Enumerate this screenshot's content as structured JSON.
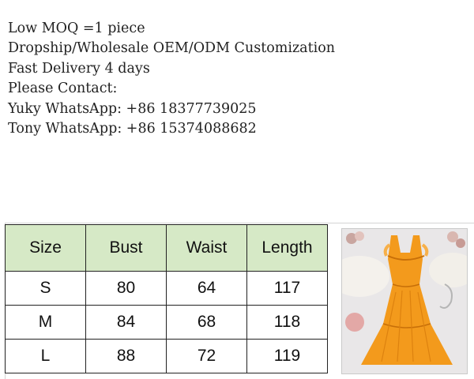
{
  "info_lines": [
    "Low MOQ =1 piece",
    "Dropship/Wholesale OEM/ODM Customization",
    "Fast Delivery 4 days",
    "Please Contact:",
    "Yuky WhatsApp: +86 18377739025",
    "Tony WhatsApp: +86 15374088682"
  ],
  "size_table": {
    "headers": [
      "Size",
      "Bust",
      "Waist",
      "Length"
    ],
    "rows": [
      [
        "S",
        "80",
        "64",
        "117"
      ],
      [
        "M",
        "84",
        "68",
        "118"
      ],
      [
        "L",
        "88",
        "72",
        "119"
      ]
    ]
  },
  "product_image": {
    "subject": "orange-ruffle-maxi-dress",
    "dress_color": "#f39a1c"
  }
}
